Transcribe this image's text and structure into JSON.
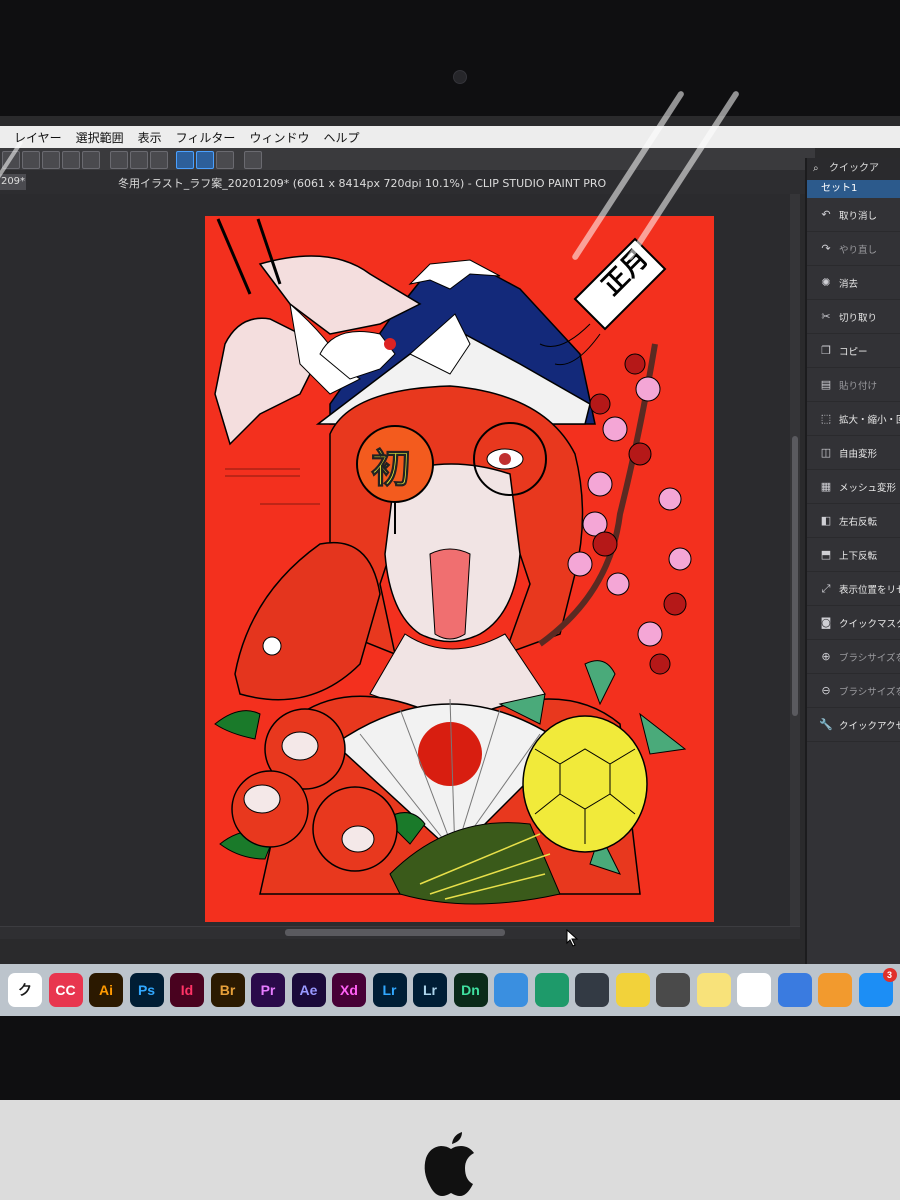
{
  "menu": [
    "レイヤー",
    "選択範囲",
    "表示",
    "フィルター",
    "ウィンドウ",
    "ヘルプ"
  ],
  "document": {
    "tab_label": "209*",
    "title": "冬用イラスト_ラフ案_20201209* (6061 x 8414px 720dpi 10.1%)  - CLIP STUDIO PAINT PRO"
  },
  "artwork": {
    "stamp_text": "初",
    "kite_text": "正月"
  },
  "quick_access": {
    "title": "クイックア",
    "set_label": "セット1",
    "items": [
      {
        "label": "取り消し",
        "icon": "undo-icon",
        "enabled": true
      },
      {
        "label": "やり直し",
        "icon": "redo-icon",
        "enabled": false
      },
      {
        "label": "消去",
        "icon": "clear-icon",
        "enabled": true
      },
      {
        "label": "切り取り",
        "icon": "scissors-icon",
        "enabled": true
      },
      {
        "label": "コピー",
        "icon": "copy-icon",
        "enabled": true
      },
      {
        "label": "貼り付け",
        "icon": "paste-icon",
        "enabled": false
      },
      {
        "label": "拡大・縮小・回転",
        "icon": "scale-rotate-icon",
        "enabled": true
      },
      {
        "label": "自由変形",
        "icon": "free-transform-icon",
        "enabled": true
      },
      {
        "label": "メッシュ変形",
        "icon": "mesh-transform-icon",
        "enabled": true
      },
      {
        "label": "左右反転",
        "icon": "flip-horizontal-icon",
        "enabled": true
      },
      {
        "label": "上下反転",
        "icon": "flip-vertical-icon",
        "enabled": true
      },
      {
        "label": "表示位置をリセット",
        "icon": "reset-view-icon",
        "enabled": true
      },
      {
        "label": "クイックマスクの変",
        "icon": "quick-mask-icon",
        "enabled": true
      },
      {
        "label": "ブラシサイズを上げ",
        "icon": "brush-size-up-icon",
        "enabled": false
      },
      {
        "label": "ブラシサイズを下げ",
        "icon": "brush-size-down-icon",
        "enabled": false
      },
      {
        "label": "クイックアクセス設定",
        "icon": "wrench-icon",
        "enabled": true
      }
    ]
  },
  "dock": [
    {
      "label": "ク",
      "name": "clip-studio",
      "bg": "#ffffff",
      "fg": "#1a1a1a"
    },
    {
      "label": "CC",
      "name": "creative-cloud",
      "bg": "#e8364f",
      "fg": "#ffffff"
    },
    {
      "label": "Ai",
      "name": "illustrator",
      "bg": "#2b1900",
      "fg": "#ff9a00"
    },
    {
      "label": "Ps",
      "name": "photoshop",
      "bg": "#001d34",
      "fg": "#31a8ff"
    },
    {
      "label": "Id",
      "name": "indesign",
      "bg": "#49021f",
      "fg": "#ff3366"
    },
    {
      "label": "Br",
      "name": "bridge",
      "bg": "#2b1a00",
      "fg": "#e7a13a"
    },
    {
      "label": "Pr",
      "name": "premiere",
      "bg": "#2a0a4a",
      "fg": "#e77cff"
    },
    {
      "label": "Ae",
      "name": "after-effects",
      "bg": "#1a0a3a",
      "fg": "#9999ff"
    },
    {
      "label": "Xd",
      "name": "xd",
      "bg": "#470137",
      "fg": "#ff61f6"
    },
    {
      "label": "Lr",
      "name": "lightroom",
      "bg": "#001e36",
      "fg": "#31a8ff"
    },
    {
      "label": "Lr",
      "name": "lightroom-classic",
      "bg": "#001e36",
      "fg": "#add5ec"
    },
    {
      "label": "Dn",
      "name": "dimension",
      "bg": "#0a2a1a",
      "fg": "#3fe0a0"
    },
    {
      "label": "",
      "name": "xcode",
      "bg": "#3a8fe0",
      "fg": "#ffffff"
    },
    {
      "label": "",
      "name": "atom",
      "bg": "#1e9a6a",
      "fg": "#ffffff"
    },
    {
      "label": "",
      "name": "brackets",
      "bg": "#333a44",
      "fg": "#ffffff"
    },
    {
      "label": "",
      "name": "cyberduck",
      "bg": "#f2d23a",
      "fg": "#333333"
    },
    {
      "label": "",
      "name": "image-capture",
      "bg": "#4a4a4a",
      "fg": "#ffffff"
    },
    {
      "label": "",
      "name": "notes",
      "bg": "#f8e27a",
      "fg": "#333333"
    },
    {
      "label": "",
      "name": "numbers",
      "bg": "#ffffff",
      "fg": "#2aa84a"
    },
    {
      "label": "",
      "name": "keynote",
      "bg": "#3a7be0",
      "fg": "#ffffff"
    },
    {
      "label": "",
      "name": "pages",
      "bg": "#f29a2e",
      "fg": "#ffffff"
    },
    {
      "label": "",
      "name": "app-store",
      "bg": "#1c8ef5",
      "fg": "#ffffff",
      "badge": "3"
    }
  ]
}
